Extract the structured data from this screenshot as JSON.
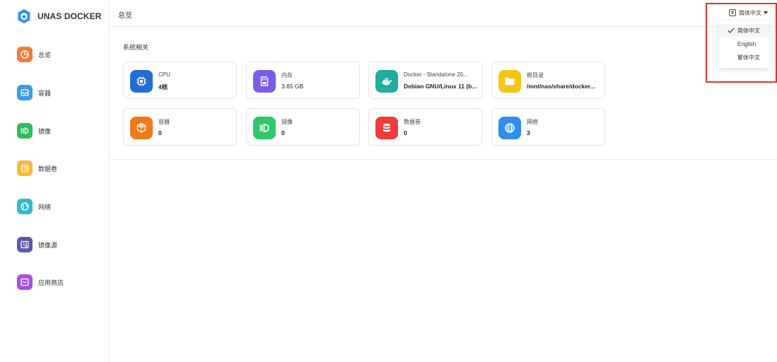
{
  "app": {
    "title": "UNAS DOCKER"
  },
  "sidebar": {
    "items": [
      {
        "label": "总览",
        "icon": "pie-chart-icon",
        "color": "#f47c3c"
      },
      {
        "label": "容器",
        "icon": "container-icon",
        "color": "#3d9be9"
      },
      {
        "label": "镜像",
        "icon": "image-layers-icon",
        "color": "#2fbd5b"
      },
      {
        "label": "数据卷",
        "icon": "database-icon",
        "color": "#f5b83a"
      },
      {
        "label": "网络",
        "icon": "globe-icon",
        "color": "#33b8c8"
      },
      {
        "label": "镜像源",
        "icon": "registry-icon",
        "color": "#5a5aa8"
      },
      {
        "label": "应用商店",
        "icon": "store-icon",
        "color": "#a84ee0"
      }
    ]
  },
  "header": {
    "title": "总览",
    "language": {
      "current": "简体中文",
      "options": [
        {
          "label": "简体中文",
          "selected": true
        },
        {
          "label": "English",
          "selected": false
        },
        {
          "label": "繁体中文",
          "selected": false
        }
      ]
    }
  },
  "main": {
    "section_title": "系统相关",
    "cards": [
      {
        "label": "CPU",
        "value": "4核",
        "icon": "cpu-icon",
        "color": "#1f6fd6"
      },
      {
        "label": "内存",
        "value": "3.65 GB",
        "icon": "memory-card-icon",
        "color": "#7b5ce8"
      },
      {
        "label": "Docker - Standalone 20...",
        "value": "Debian GNU/Linux 11 (b...",
        "icon": "docker-whale-icon",
        "color": "#1fae9f"
      },
      {
        "label": "根目录",
        "value": "/mnt/nas/share/docker...",
        "icon": "folder-icon",
        "color": "#f5c419"
      },
      {
        "label": "容器",
        "value": "0",
        "icon": "cube-icon",
        "color": "#f07a1a"
      },
      {
        "label": "镜像",
        "value": "0",
        "icon": "image-layers-icon",
        "color": "#2ec76a"
      },
      {
        "label": "数据卷",
        "value": "0",
        "icon": "database-icon",
        "color": "#ee3b3b"
      },
      {
        "label": "网络",
        "value": "3",
        "icon": "globe-icon",
        "color": "#2f8fea"
      }
    ]
  }
}
